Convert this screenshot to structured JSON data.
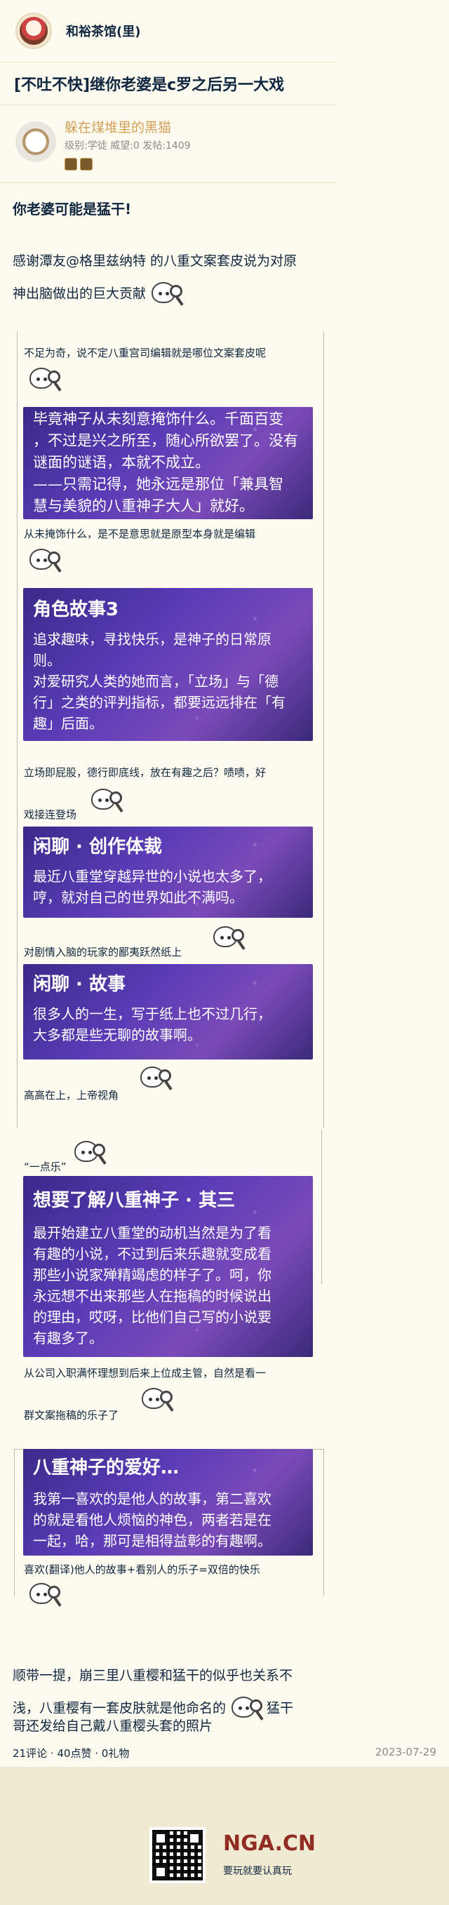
{
  "header": {
    "forum_name": "和裕茶馆(里)"
  },
  "post": {
    "title": "[不吐不快]继你老婆是c罗之后另一大戏",
    "author": {
      "name": "躲在煤堆里的黑猫",
      "meta": "级别:学徒 威望:0 发帖:1409"
    },
    "heading": "你老婆可能是猛干!",
    "intro_line1": "感谢潭友@格里兹纳特 的八重文案套皮说为对原",
    "intro_line2": "神出脑做出的巨大贡献",
    "quotes": [
      "不足为奇，说不定八重宫司编辑就是哪位文案套皮呢",
      "从未掩饰什么，是不是意思就是原型本身就是编辑",
      "立场即屁股，德行即底线，放在有趣之后？啧啧，好",
      "戏接连登场",
      "对剧情入脑的玩家的鄙夷跃然纸上",
      "高高在上，上帝视角",
      "“一点乐”",
      "从公司入职满怀理想到后来上位成主管，自然是看一",
      "群文案拖稿的乐子了",
      "喜欢(翻译)他人的故事+看别人的乐子=双倍的快乐"
    ],
    "cards": [
      {
        "title": "",
        "lines": [
          "毕竟神子从未刻意掩饰什么。千面百变",
          "，不过是兴之所至，随心所欲罢了。没有",
          "谜面的谜语，本就不成立。",
          "——只需记得，她永远是那位「兼具智",
          "慧与美貌的八重神子大人」就好。"
        ]
      },
      {
        "title": "角色故事3",
        "lines": [
          "追求趣味，寻找快乐，是神子的日常原",
          "则。",
          "对爱研究人类的她而言，「立场」与「德",
          "行」之类的评判指标，都要远远排在「有",
          "趣」后面。"
        ]
      },
      {
        "title": "闲聊 · 创作体裁",
        "lines": [
          "最近八重堂穿越异世的小说也太多了，",
          "哼，就对自己的世界如此不满吗。"
        ]
      },
      {
        "title": "闲聊 · 故事",
        "lines": [
          "很多人的一生，写于纸上也不过几行，",
          "大多都是些无聊的故事啊。"
        ]
      },
      {
        "title": "想要了解八重神子 · 其三",
        "lines": [
          "最开始建立八重堂的动机当然是为了看",
          "有趣的小说，不过到后来乐趣就变成看",
          "那些小说家殚精竭虑的样子了。呵，你",
          "永远想不出来那些人在拖稿的时候说出",
          "的理由，哎呀，比他们自己写的小说要",
          "有趣多了。"
        ]
      },
      {
        "title": "八重神子的爱好…",
        "lines": [
          "我第一喜欢的是他人的故事，第二喜欢",
          "的就是看他人烦恼的神色，两者若是在",
          "一起，哈，那可是相得益彰的有趣啊。"
        ]
      }
    ],
    "outro_line1": "顺带一提，崩三里八重樱和猛干的似乎也关系不",
    "outro_line2": "浅，八重樱有一套皮肤就是他命名的",
    "outro_line2b": "猛干",
    "outro_line3": "哥还发给自己戴八重樱头套的照片",
    "stats": "21评论 · 40点赞 · 0礼物",
    "date": "2023-07-29"
  },
  "footer": {
    "logo": "NGA.CN",
    "slogan": "要玩就要认真玩"
  },
  "icons": [
    "avatar",
    "author-avatar",
    "badge-icon",
    "doge-sticker-icon",
    "qr-code"
  ],
  "colors": {
    "background": "#fdfaef",
    "author_name": "#d2a25a",
    "card_purple": "#5a3cb6",
    "footer_bg": "#f1ead2"
  }
}
